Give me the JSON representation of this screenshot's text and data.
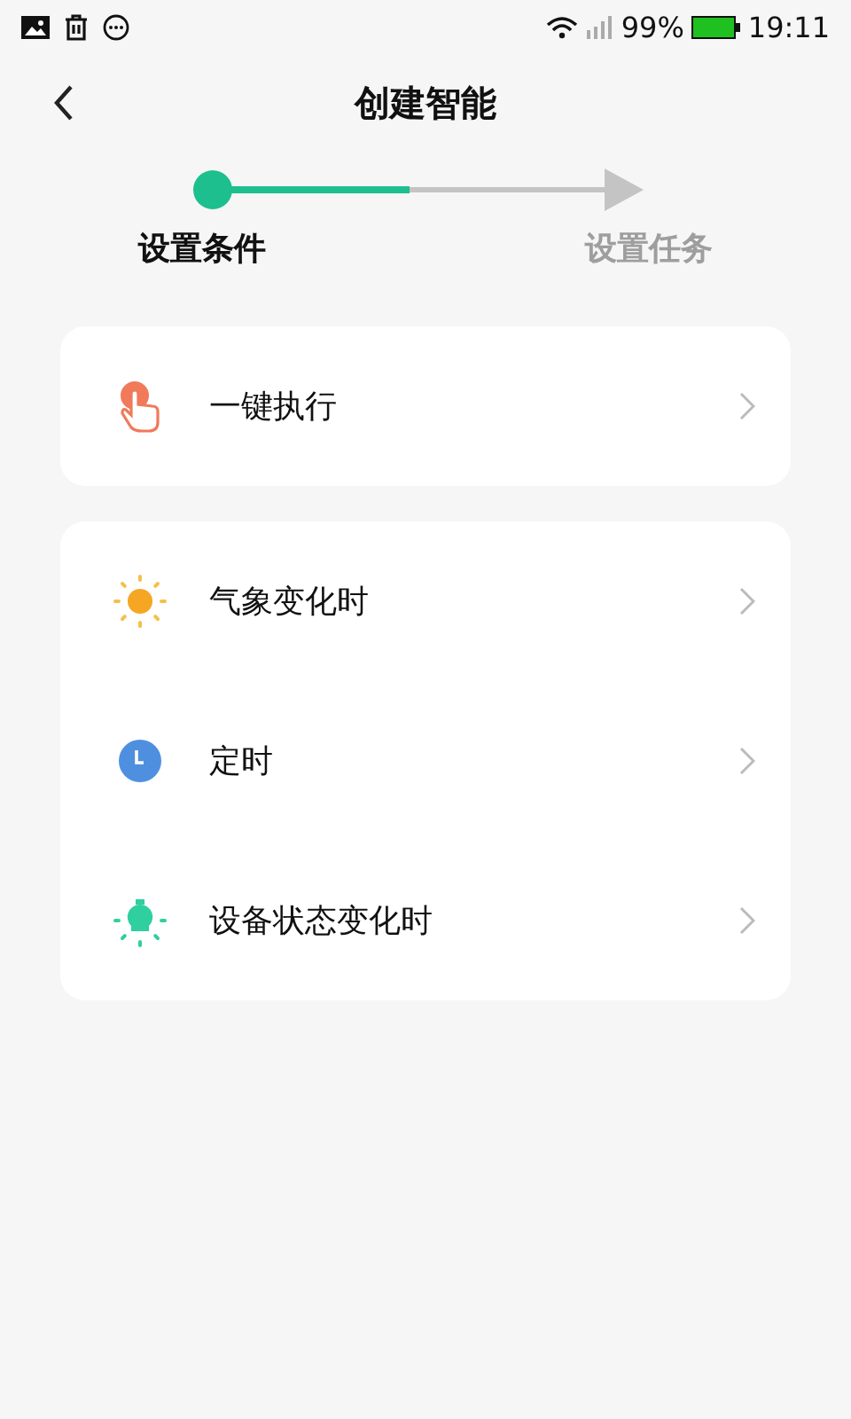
{
  "status_bar": {
    "battery": "99%",
    "time": "19:11"
  },
  "header": {
    "title": "创建智能"
  },
  "steps": {
    "level": 0.5,
    "items": [
      {
        "label": "设置条件",
        "selected": true
      },
      {
        "label": "设置任务",
        "selected": false
      }
    ]
  },
  "groups": [
    {
      "items": [
        {
          "kind": "touch",
          "label": "一键执行"
        }
      ]
    },
    {
      "items": [
        {
          "kind": "sun",
          "label": "气象变化时"
        },
        {
          "kind": "clock",
          "label": "定时"
        },
        {
          "kind": "bulb",
          "label": "设备状态变化时"
        }
      ]
    }
  ]
}
